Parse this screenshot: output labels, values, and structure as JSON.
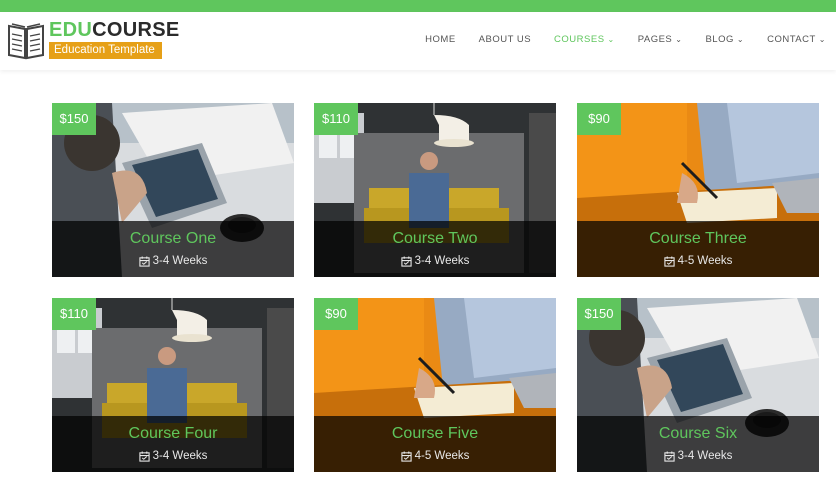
{
  "brand": {
    "name_part1": "EDU",
    "name_part2": "COURSE",
    "tagline": "Education Template"
  },
  "colors": {
    "accent": "#5fc65d",
    "tag": "#e6a017",
    "text": "#555555"
  },
  "nav": {
    "items": [
      {
        "label": "HOME",
        "has_dropdown": false,
        "active": false
      },
      {
        "label": "ABOUT US",
        "has_dropdown": false,
        "active": false
      },
      {
        "label": "COURSES",
        "has_dropdown": true,
        "active": true
      },
      {
        "label": "PAGES",
        "has_dropdown": true,
        "active": false
      },
      {
        "label": "BLOG",
        "has_dropdown": true,
        "active": false
      },
      {
        "label": "CONTACT",
        "has_dropdown": true,
        "active": false
      }
    ]
  },
  "courses": [
    {
      "title": "Course One",
      "price": "$150",
      "duration": "3-4 Weeks",
      "photo": "tablet"
    },
    {
      "title": "Course Two",
      "price": "$110",
      "duration": "3-4 Weeks",
      "photo": "lounge"
    },
    {
      "title": "Course Three",
      "price": "$90",
      "duration": "4-5 Weeks",
      "photo": "writing"
    },
    {
      "title": "Course Four",
      "price": "$110",
      "duration": "3-4 Weeks",
      "photo": "lounge"
    },
    {
      "title": "Course Five",
      "price": "$90",
      "duration": "4-5 Weeks",
      "photo": "writing"
    },
    {
      "title": "Course Six",
      "price": "$150",
      "duration": "3-4 Weeks",
      "photo": "tablet"
    }
  ]
}
